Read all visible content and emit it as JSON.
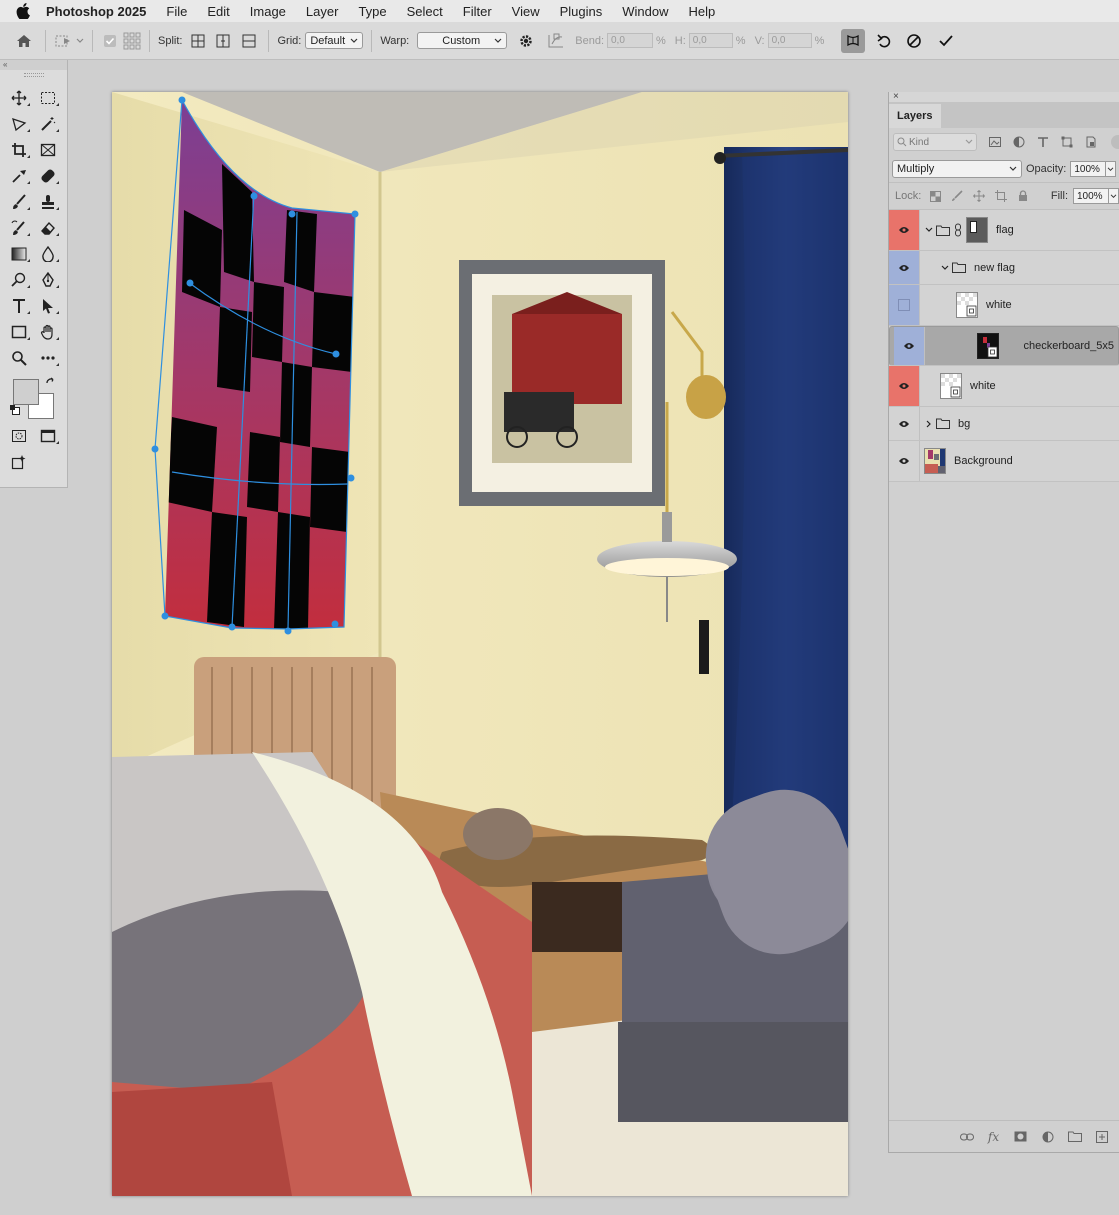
{
  "menubar": {
    "app_name": "Photoshop 2025",
    "menus": [
      "File",
      "Edit",
      "Image",
      "Layer",
      "Type",
      "Select",
      "Filter",
      "View",
      "Plugins",
      "Window",
      "Help"
    ]
  },
  "options_bar": {
    "split_label": "Split:",
    "grid_label": "Grid:",
    "grid_value": "Default",
    "warp_label": "Warp:",
    "warp_value": "Custom",
    "bend_label": "Bend:",
    "bend_value": "0,0",
    "bend_unit": "%",
    "h_label": "H:",
    "h_value": "0,0",
    "h_unit": "%",
    "v_label": "V:",
    "v_value": "0,0",
    "v_unit": "%"
  },
  "layers_panel": {
    "tab_label": "Layers",
    "kind_placeholder": "Kind",
    "blend_mode": "Multiply",
    "opacity_label": "Opacity:",
    "opacity_value": "100%",
    "lock_label": "Lock:",
    "fill_label": "Fill:",
    "fill_value": "100%",
    "layers": [
      {
        "name": "flag",
        "type": "group",
        "expanded": true,
        "visible": true,
        "color": "#e8736a"
      },
      {
        "name": "new flag",
        "type": "group",
        "expanded": true,
        "visible": true,
        "color": "#9fb0d8"
      },
      {
        "name": "white",
        "type": "smart",
        "visible": false,
        "color": "#9fb0d8"
      },
      {
        "name": "checkerboard_5x5",
        "type": "smart",
        "visible": true,
        "selected": true,
        "color": "#9fb0d8"
      },
      {
        "name": "white",
        "type": "smart",
        "visible": true,
        "color": "#e8736a"
      },
      {
        "name": "bg",
        "type": "group",
        "expanded": false,
        "visible": true
      },
      {
        "name": "Background",
        "type": "image",
        "visible": true
      }
    ]
  },
  "colors": {
    "flag_top": "#7b3f95",
    "flag_bottom": "#c52d3a",
    "warp_handle": "#2e8fe0",
    "wall": "#efe6b6",
    "curtain": "#1f3873"
  }
}
